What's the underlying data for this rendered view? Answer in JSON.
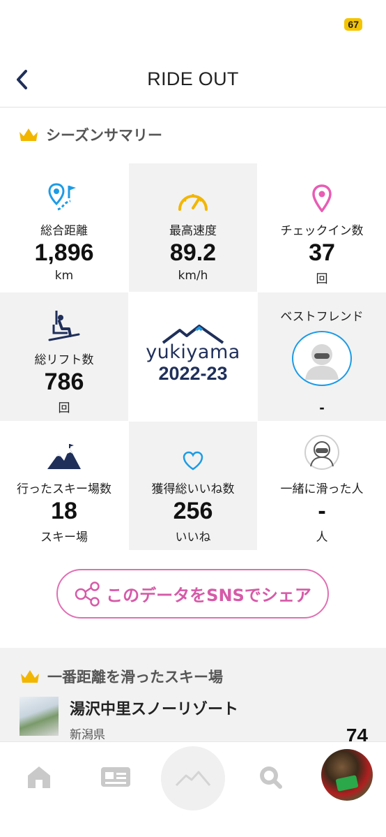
{
  "status_bar": {
    "battery": "67"
  },
  "nav": {
    "title": "RIDE OUT"
  },
  "summary": {
    "title": "シーズンサマリー",
    "cells": [
      {
        "label": "総合距離",
        "value": "1,896",
        "unit": "km"
      },
      {
        "label": "最高速度",
        "value": "89.2",
        "unit": "km/h"
      },
      {
        "label": "チェックイン数",
        "value": "37",
        "unit": "回"
      },
      {
        "label": "総リフト数",
        "value": "786",
        "unit": "回"
      },
      {
        "logo": "yukiyama",
        "season": "2022-23"
      },
      {
        "label": "ベストフレンド",
        "value": "-"
      },
      {
        "label": "行ったスキー場数",
        "value": "18",
        "unit": "スキー場"
      },
      {
        "label": "獲得総いいね数",
        "value": "256",
        "unit": "いいね"
      },
      {
        "label": "一緒に滑った人",
        "value": "-",
        "unit": "人"
      }
    ]
  },
  "share": {
    "label": "このデータをSNSでシェア"
  },
  "top_resort": {
    "title": "一番距離を滑ったスキー場",
    "name": "湯沢中里スノーリゾート",
    "prefecture": "新潟県",
    "value": "74"
  },
  "colors": {
    "accent_blue": "#1c9be6",
    "gold": "#f2b600",
    "pink": "#e06fb4",
    "navy": "#1f2f5a"
  }
}
